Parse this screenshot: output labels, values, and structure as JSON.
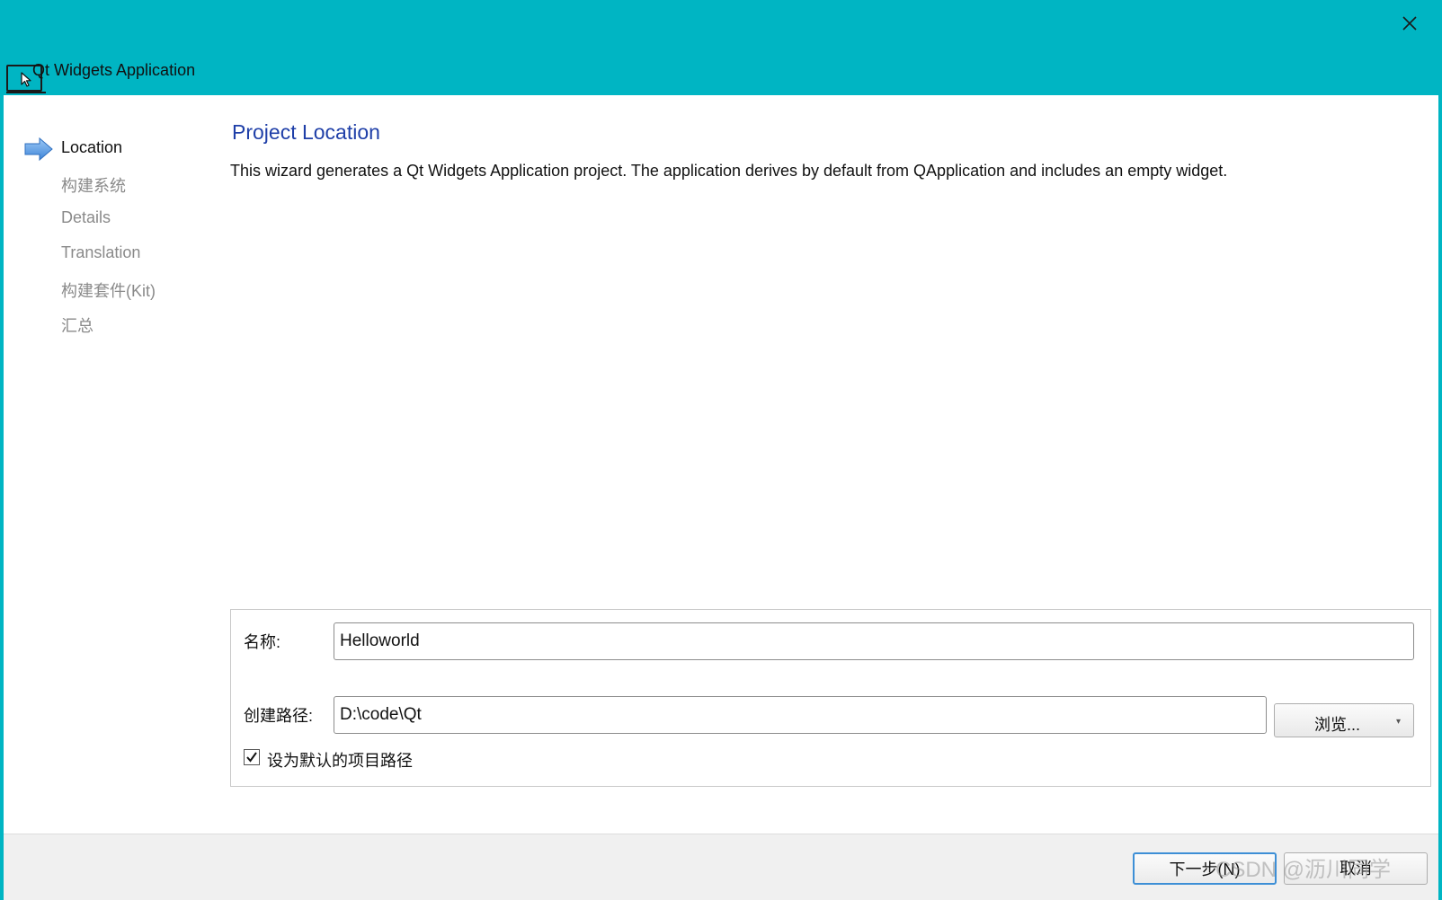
{
  "window": {
    "title": "Qt Widgets Application",
    "close_icon": "close-icon",
    "accent_color": "#00b5c3"
  },
  "sidebar": {
    "items": [
      {
        "label": "Location",
        "active": true
      },
      {
        "label": "构建系统",
        "active": false
      },
      {
        "label": "Details",
        "active": false
      },
      {
        "label": "Translation",
        "active": false
      },
      {
        "label": "构建套件(Kit)",
        "active": false
      },
      {
        "label": "汇总",
        "active": false
      }
    ]
  },
  "main": {
    "title": "Project Location",
    "description": "This wizard generates a Qt Widgets Application project. The application derives by default from QApplication and includes an empty widget.",
    "form": {
      "name_label": "名称:",
      "name_value": "Helloworld",
      "path_label": "创建路径:",
      "path_value": "D:\\code\\Qt",
      "browse_label": "浏览...",
      "default_path_label": "设为默认的项目路径",
      "default_path_checked": true
    }
  },
  "footer": {
    "next_label": "下一步(N)",
    "cancel_label": "取消"
  },
  "watermark": "CSDN @沥川同学"
}
